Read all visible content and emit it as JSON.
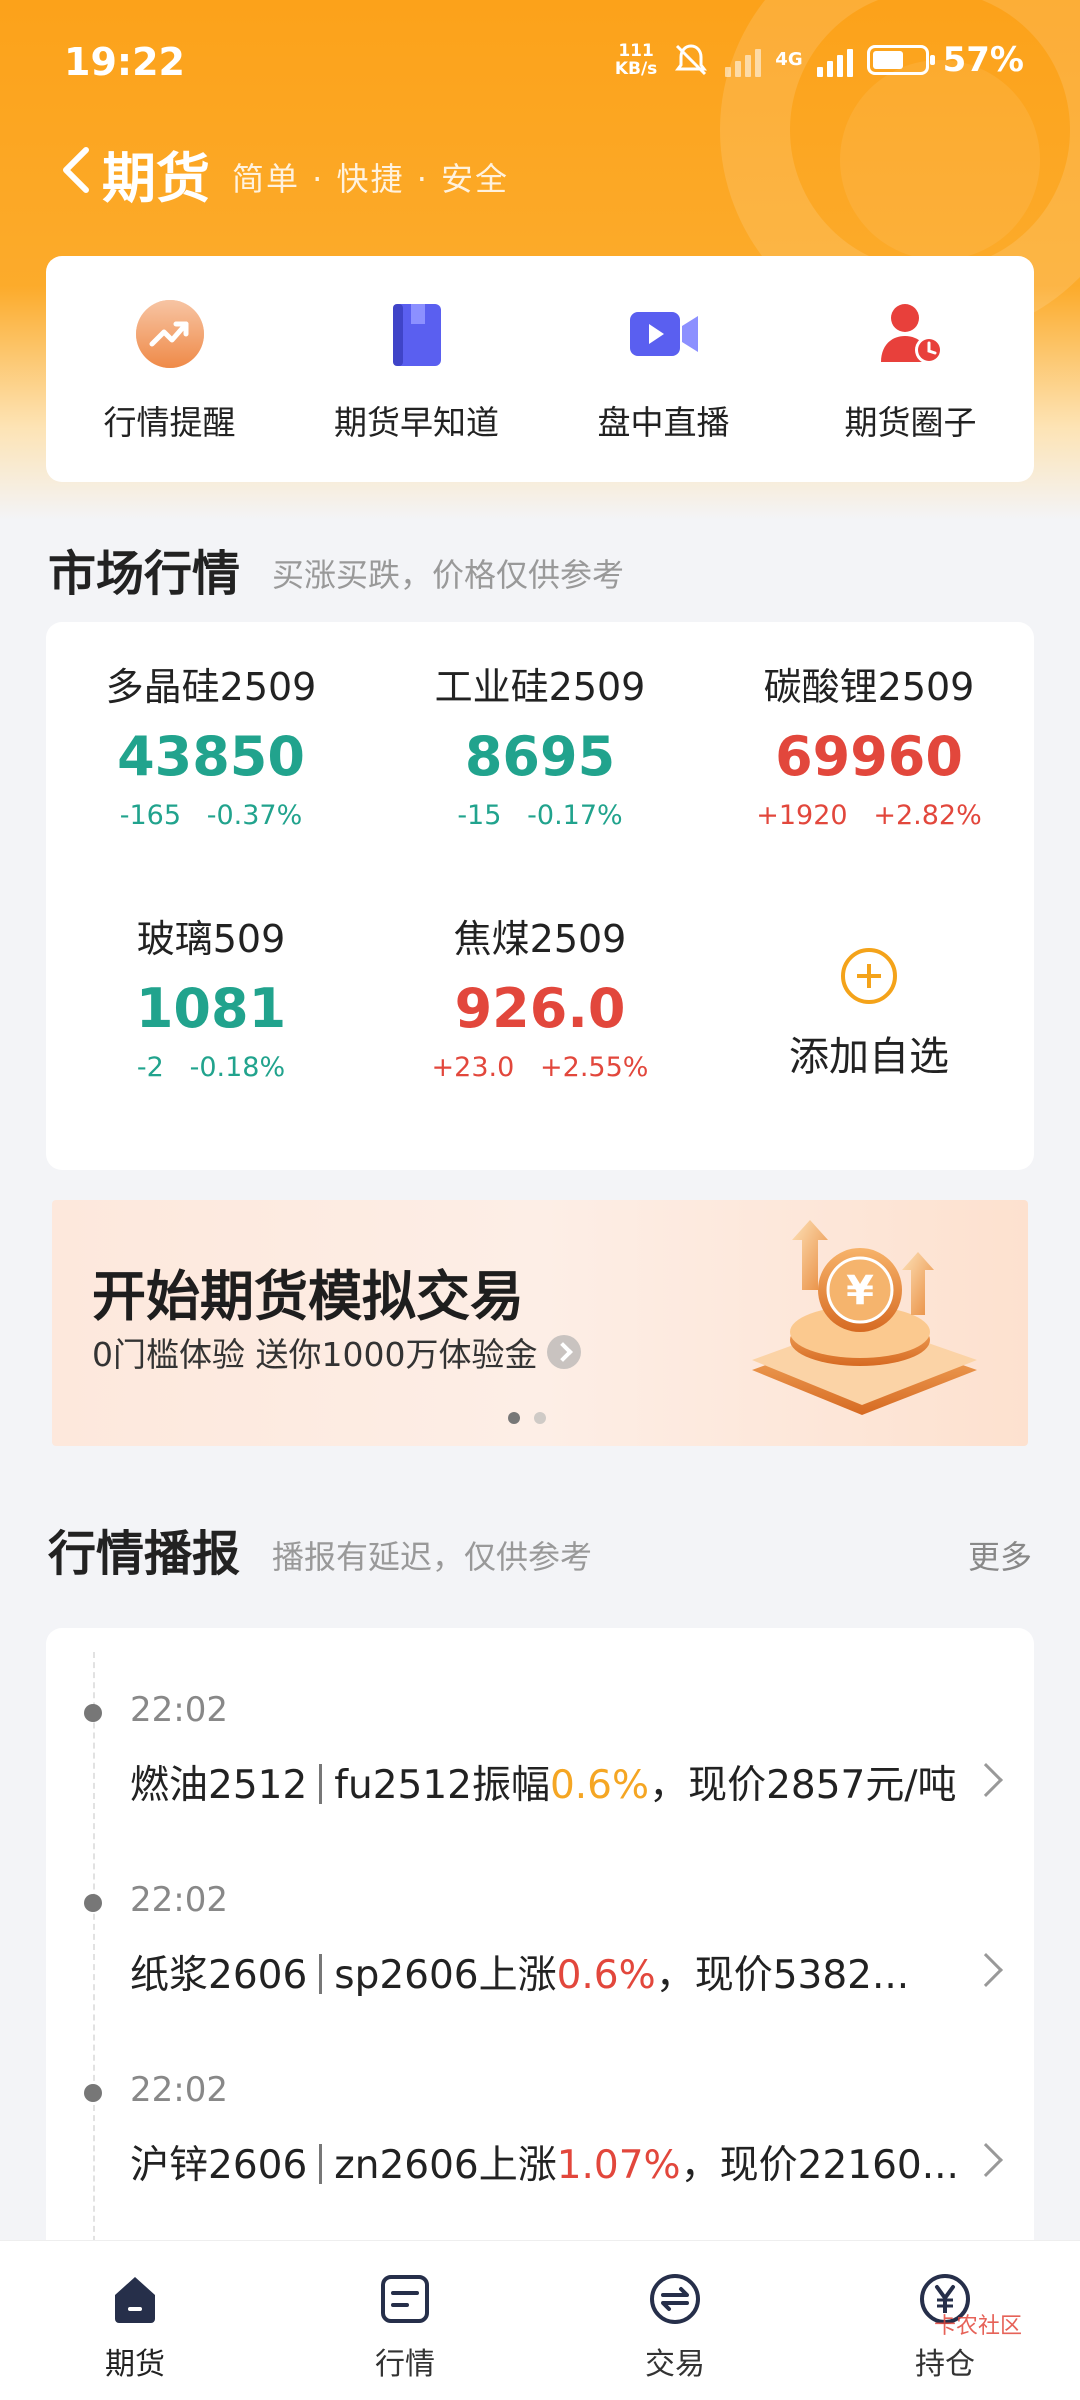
{
  "status_bar": {
    "time": "19:22",
    "net_speed_value": "111",
    "net_speed_unit": "KB/s",
    "network": "4G",
    "battery": "57%"
  },
  "header": {
    "title": "期货",
    "slogan": "简单 · 快捷 · 安全"
  },
  "quick_actions": [
    {
      "label": "行情提醒",
      "icon": "trend-alert-icon",
      "color": "#f08a3c"
    },
    {
      "label": "期货早知道",
      "icon": "book-icon",
      "color": "#5a5ff0"
    },
    {
      "label": "盘中直播",
      "icon": "video-camera-icon",
      "color": "#5a5ff0"
    },
    {
      "label": "期货圈子",
      "icon": "user-group-icon",
      "color": "#e8403b"
    }
  ],
  "market": {
    "title": "市场行情",
    "subtitle": "买涨买跌，价格仅供参考",
    "quotes": [
      {
        "name": "多晶硅2509",
        "price": "43850",
        "change": "-165",
        "percent": "-0.37%",
        "direction": "down"
      },
      {
        "name": "工业硅2509",
        "price": "8695",
        "change": "-15",
        "percent": "-0.17%",
        "direction": "down"
      },
      {
        "name": "碳酸锂2509",
        "price": "69960",
        "change": "+1920",
        "percent": "+2.82%",
        "direction": "up"
      },
      {
        "name": "玻璃509",
        "price": "1081",
        "change": "-2",
        "percent": "-0.18%",
        "direction": "down"
      },
      {
        "name": "焦煤2509",
        "price": "926.0",
        "change": "+23.0",
        "percent": "+2.55%",
        "direction": "up"
      }
    ],
    "add_label": "添加自选"
  },
  "banner": {
    "title": "开始期货模拟交易",
    "subtitle": "0门槛体验 送你1000万体验金",
    "coin_symbol": "¥",
    "page_count": 2,
    "active_index": 0
  },
  "broadcast": {
    "title": "行情播报",
    "subtitle": "播报有延迟，仅供参考",
    "more_label": "更多",
    "items": [
      {
        "time": "22:02",
        "name": "燃油2512",
        "code_desc": "fu2512振幅",
        "pct": "0.6%",
        "rest": "，现价2857元/吨",
        "pct_color": "orange"
      },
      {
        "time": "22:02",
        "name": "纸浆2606",
        "code_desc": "sp2606上涨",
        "pct": "0.6%",
        "rest": "，现价5382...",
        "pct_color": "red"
      },
      {
        "time": "22:02",
        "name": "沪锌2606",
        "code_desc": "zn2606上涨",
        "pct": "1.07%",
        "rest": "，现价22160...",
        "pct_color": "red"
      }
    ]
  },
  "bottom_nav": [
    {
      "label": "期货",
      "icon": "home-icon",
      "active": true
    },
    {
      "label": "行情",
      "icon": "quotes-icon",
      "active": false
    },
    {
      "label": "交易",
      "icon": "exchange-icon",
      "active": false
    },
    {
      "label": "持仓",
      "icon": "yen-coin-icon",
      "active": false
    }
  ],
  "watermark": "卡农社区"
}
